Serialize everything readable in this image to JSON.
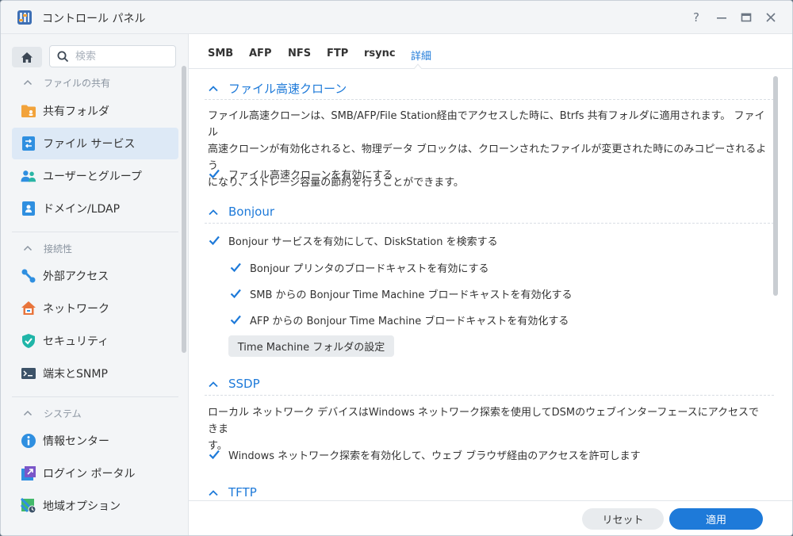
{
  "window": {
    "title": "コントロール パネル",
    "controls": {
      "help": "?",
      "minimize": "—",
      "maximize": "▭",
      "close": "✕"
    }
  },
  "sidebar": {
    "search_placeholder": "検索",
    "groups": [
      {
        "title": "ファイルの共有",
        "items": [
          {
            "label": "共有フォルダ",
            "icon": "shared-folder-icon"
          },
          {
            "label": "ファイル サービス",
            "icon": "file-services-icon",
            "active": true
          },
          {
            "label": "ユーザーとグループ",
            "icon": "users-groups-icon"
          },
          {
            "label": "ドメイン/LDAP",
            "icon": "domain-ldap-icon"
          }
        ]
      },
      {
        "title": "接続性",
        "items": [
          {
            "label": "外部アクセス",
            "icon": "external-access-icon"
          },
          {
            "label": "ネットワーク",
            "icon": "network-icon"
          },
          {
            "label": "セキュリティ",
            "icon": "security-shield-icon"
          },
          {
            "label": "端末とSNMP",
            "icon": "terminal-icon"
          }
        ]
      },
      {
        "title": "システム",
        "items": [
          {
            "label": "情報センター",
            "icon": "info-center-icon"
          },
          {
            "label": "ログイン ポータル",
            "icon": "login-portal-icon"
          },
          {
            "label": "地域オプション",
            "icon": "regional-options-icon"
          }
        ]
      }
    ]
  },
  "tabs": [
    "SMB",
    "AFP",
    "NFS",
    "FTP",
    "rsync",
    "詳細"
  ],
  "active_tab": "詳細",
  "sections": {
    "clone": {
      "title": "ファイル高速クローン",
      "desc_lines": [
        "ファイル高速クローンは、SMB/AFP/File Station経由でアクセスした時に、Btrfs 共有フォルダに適用されます。 ファイル",
        "高速クローンが有効化されると、物理データ ブロックは、クローンされたファイルが変更された時にのみコピーされるよう",
        "になり、ストレージ容量の節約を行うことができます。"
      ],
      "checkbox": {
        "label": "ファイル高速クローンを有効にする",
        "checked": true
      }
    },
    "bonjour": {
      "title": "Bonjour",
      "main": {
        "label": "Bonjour サービスを有効にして、DiskStation を検索する",
        "checked": true
      },
      "printer": {
        "label": "Bonjour プリンタのブロードキャストを有効にする",
        "checked": true
      },
      "smb_tm": {
        "label": "SMB からの Bonjour Time Machine ブロードキャストを有効化する",
        "checked": true
      },
      "afp_tm": {
        "label": "AFP からの Bonjour Time Machine ブロードキャストを有効化する",
        "checked": true
      },
      "tm_button": "Time Machine フォルダの設定"
    },
    "ssdp": {
      "title": "SSDP",
      "desc_lines": [
        "ローカル ネットワーク デバイスはWindows ネットワーク探索を使用してDSMのウェブインターフェースにアクセスできま",
        "す。"
      ],
      "checkbox": {
        "label": "Windows ネットワーク探索を有効化して、ウェブ ブラウザ経由のアクセスを許可します",
        "checked": true
      }
    },
    "tftp": {
      "title": "TFTP"
    }
  },
  "footer": {
    "reset": "リセット",
    "apply": "適用"
  },
  "colors": {
    "accent": "#1e7ad9",
    "sidebar_bg": "#f3f5f7",
    "active_bg": "#dde9f6"
  }
}
